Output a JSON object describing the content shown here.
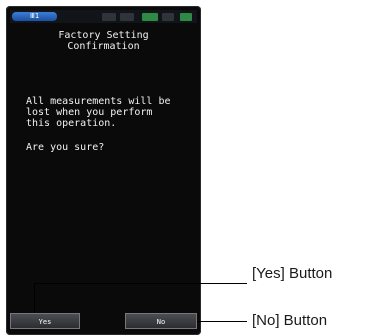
{
  "device": {
    "status_bar": {
      "battery_label": "Ⅲ1"
    },
    "screen": {
      "title_line1": "Factory Setting",
      "title_line2": "Confirmation",
      "message_line1": "All measurements will be",
      "message_line2": "lost when you perform",
      "message_line3": "this operation.",
      "question": "Are you sure?"
    },
    "buttons": {
      "yes_label": "Yes",
      "no_label": "No"
    }
  },
  "callouts": {
    "yes": "[Yes] Button",
    "no": "[No] Button"
  },
  "colors": {
    "screen_bg": "#0a0a0a",
    "screen_text": "#f2f2f2",
    "status_accent": "#3b7fd6",
    "status_green": "#2e8a45"
  }
}
